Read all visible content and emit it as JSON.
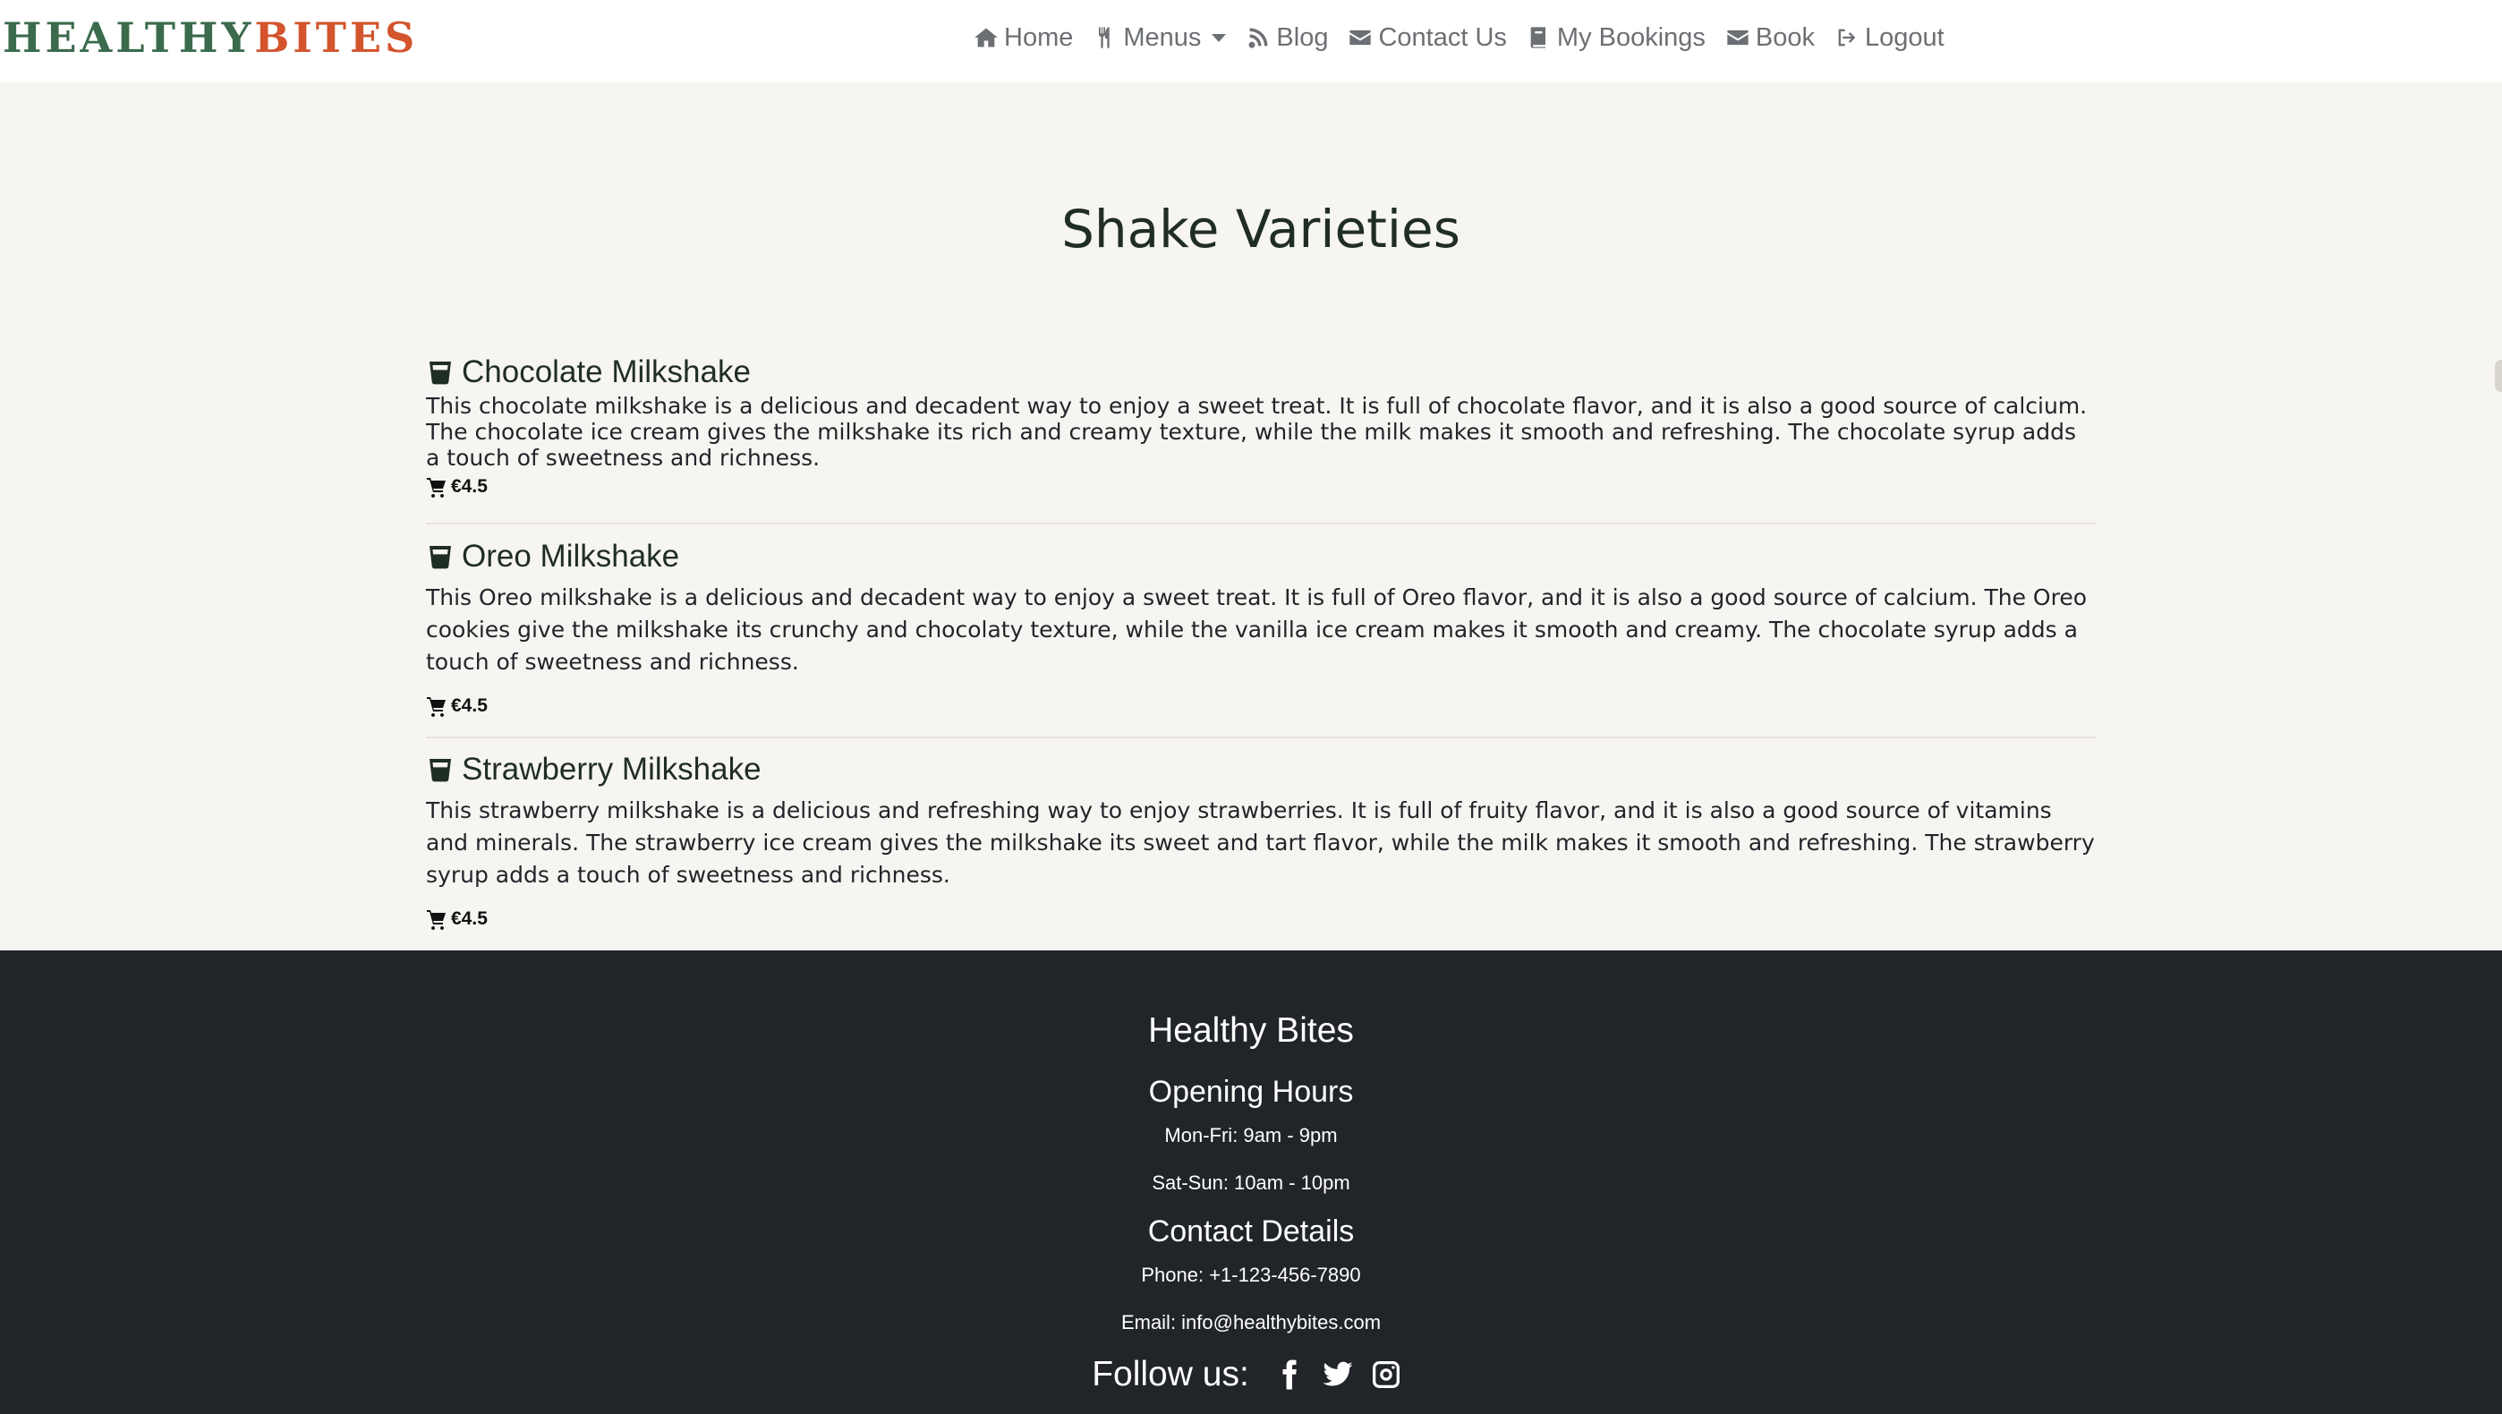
{
  "brand": {
    "part1": "HEALTHY",
    "part2": "BITES"
  },
  "nav": {
    "home": "Home",
    "menus": "Menus",
    "blog": "Blog",
    "contact": "Contact Us",
    "bookings": "My Bookings",
    "book": "Book",
    "logout": "Logout"
  },
  "page": {
    "title": "Shake Varieties"
  },
  "items": [
    {
      "name": "Chocolate Milkshake",
      "description": "This chocolate milkshake is a delicious and decadent way to enjoy a sweet treat. It is full of chocolate flavor, and it is also a good source of calcium. The chocolate ice cream gives the milkshake its rich and creamy texture, while the milk makes it smooth and refreshing. The chocolate syrup adds a touch of sweetness and richness.",
      "price": "€4.5"
    },
    {
      "name": "Oreo Milkshake",
      "description": "This Oreo milkshake is a delicious and decadent way to enjoy a sweet treat. It is full of Oreo flavor, and it is also a good source of calcium. The Oreo cookies give the milkshake its crunchy and chocolaty texture, while the vanilla ice cream makes it smooth and creamy. The chocolate syrup adds a touch of sweetness and richness.",
      "price": "€4.5"
    },
    {
      "name": "Strawberry Milkshake",
      "description": "This strawberry milkshake is a delicious and refreshing way to enjoy strawberries. It is full of fruity flavor, and it is also a good source of vitamins and minerals. The strawberry ice cream gives the milkshake its sweet and tart flavor, while the milk makes it smooth and refreshing. The strawberry syrup adds a touch of sweetness and richness.",
      "price": "€4.5"
    }
  ],
  "footer": {
    "title": "Healthy Bites",
    "hours_heading": "Opening Hours",
    "hours_weekday": "Mon-Fri: 9am - 9pm",
    "hours_weekend": "Sat-Sun: 10am - 10pm",
    "contact_heading": "Contact Details",
    "phone": "Phone: +1-123-456-7890",
    "email": "Email: info@healthybites.com",
    "follow_label": "Follow us:"
  },
  "icons": {
    "glass": "glass-icon",
    "cart": "cart-icon",
    "social": [
      "facebook-icon",
      "twitter-icon",
      "instagram-icon"
    ]
  },
  "colors": {
    "brand_green": "#3b6b4c",
    "brand_orange": "#d3542d",
    "footer_bg": "#212429",
    "page_bg": "#f7f5f1"
  }
}
